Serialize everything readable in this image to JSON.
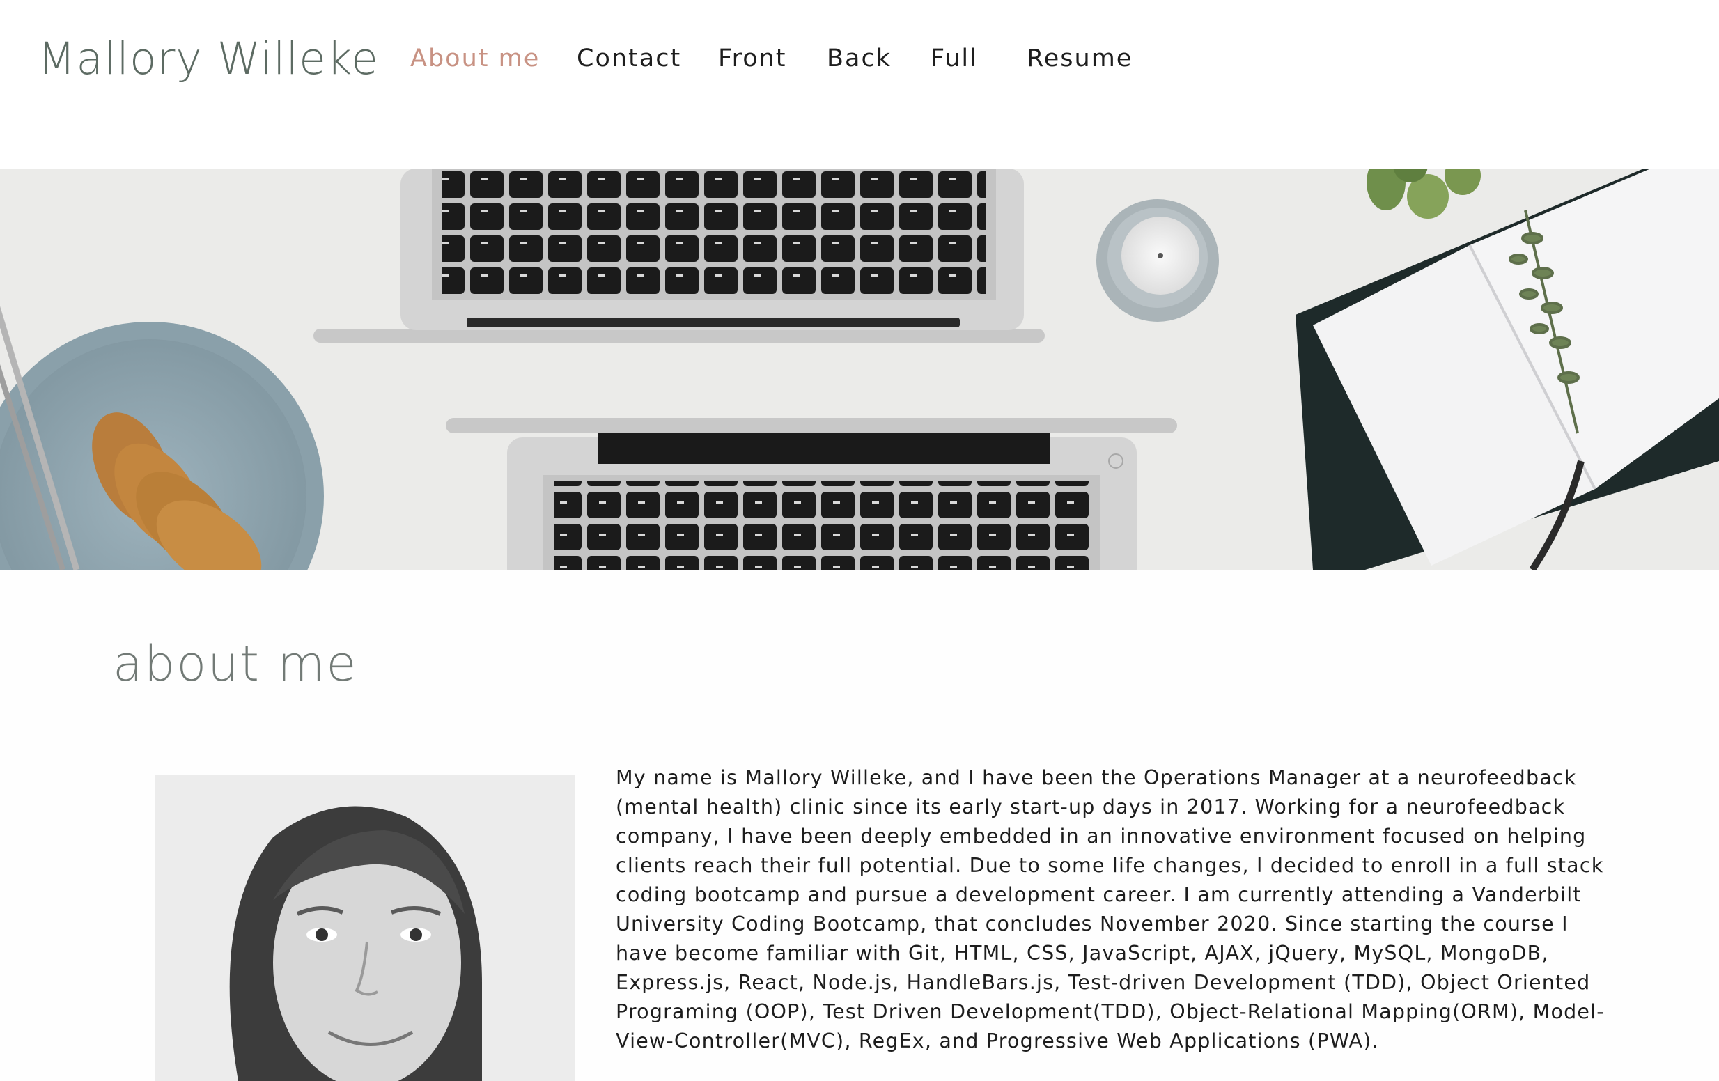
{
  "brand": {
    "name": "Mallory Willeke"
  },
  "nav": {
    "items": [
      {
        "label": "About me",
        "active": true
      },
      {
        "label": "Contact",
        "active": false
      },
      {
        "label": "Front",
        "active": false
      },
      {
        "label": "Back",
        "active": false
      },
      {
        "label": "Full",
        "active": false
      },
      {
        "label": "Resume",
        "active": false
      }
    ],
    "active_color": "#c89283"
  },
  "hero": {
    "icons": [
      "laptop-icon",
      "candle-icon",
      "notebook-icon",
      "cookie-bowl-icon",
      "plant-icon"
    ]
  },
  "about": {
    "title": "about me",
    "bio": "My name is Mallory Willeke, and I have been the Operations Manager at a neurofeedback (mental health) clinic since its early start-up days in 2017. Working for a neurofeedback company, I have been deeply embedded in an innovative environment focused on helping clients reach their full potential. Due to some life changes, I decided to enroll in a full stack coding bootcamp and pursue a development career. I am currently attending a Vanderbilt University Coding Bootcamp, that concludes November 2020. Since starting the course I have become familiar with Git, HTML, CSS, JavaScript, AJAX, jQuery, MySQL, MongoDB, Express.js, React, Node.js, HandleBars.js, Test-driven Development (TDD), Object Oriented Programing (OOP), Test Driven Development(TDD), Object-Relational Mapping(ORM), Model-View-Controller(MVC), RegEx, and Progressive Web Applications (PWA)."
  },
  "colors": {
    "brand": "#5d6b63",
    "heading": "#727a76",
    "text": "#1d1d1d",
    "background": "#fefefe"
  }
}
